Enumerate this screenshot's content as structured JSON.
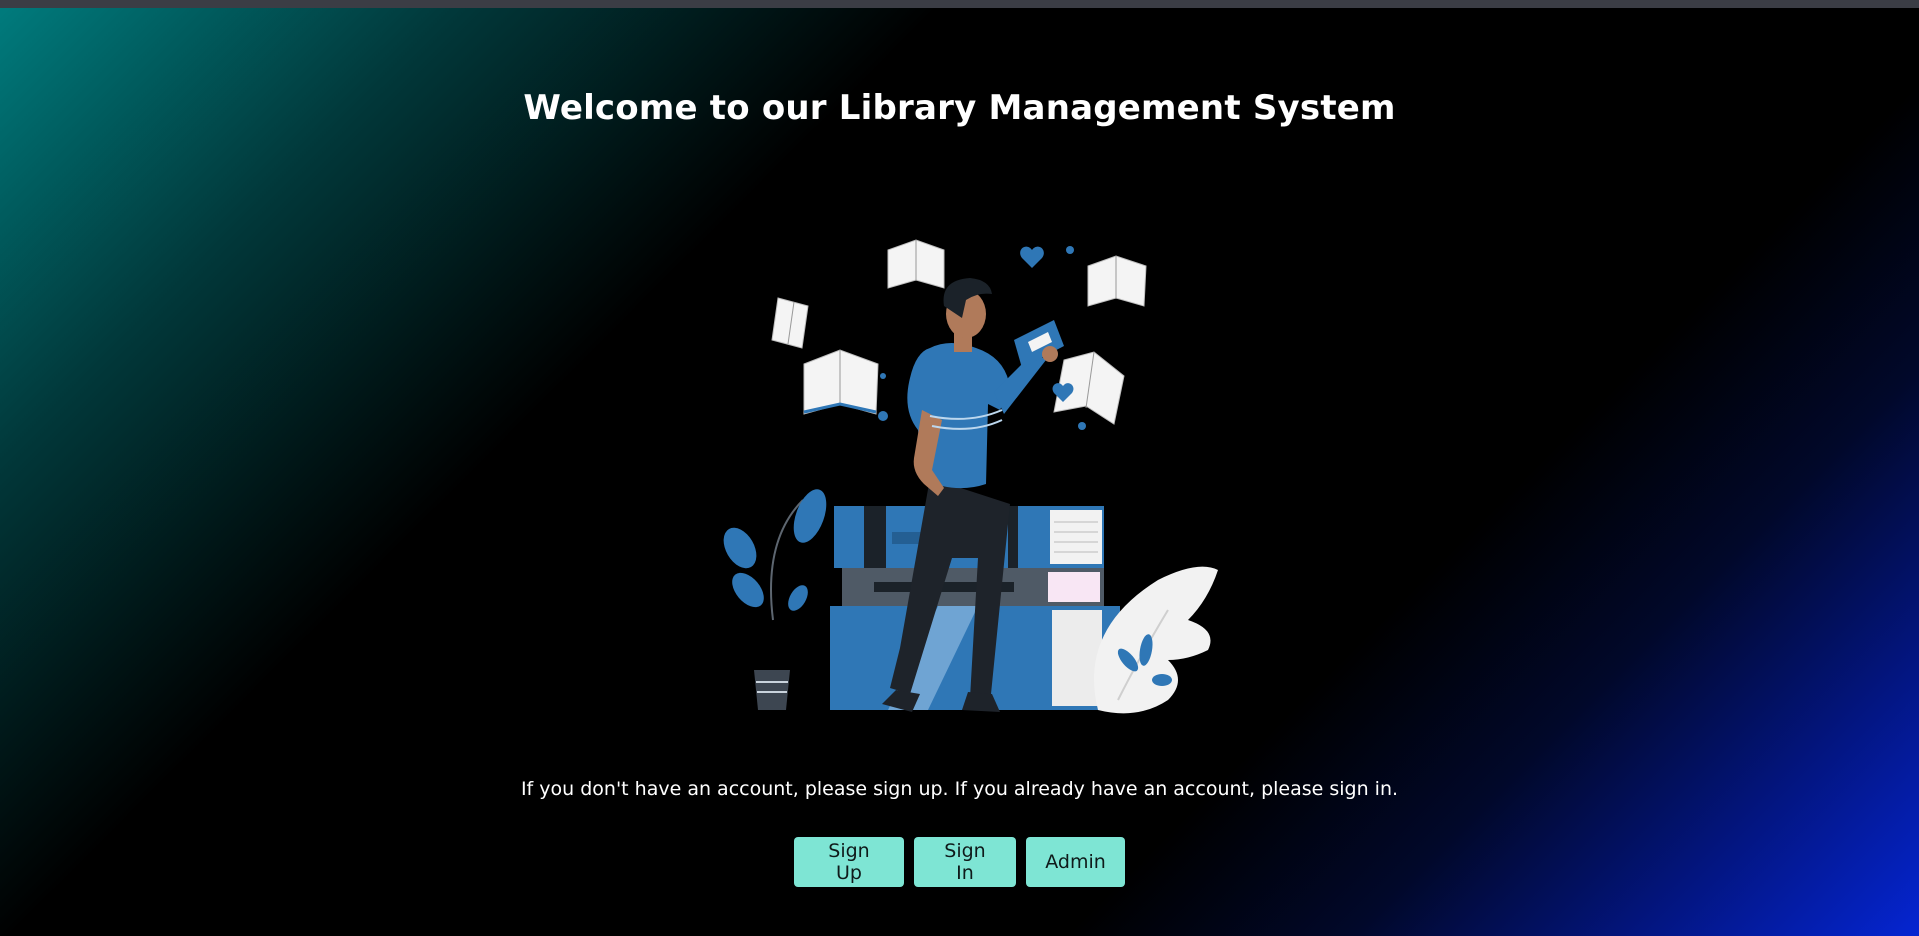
{
  "page": {
    "title": "Welcome to our Library Management System",
    "message": "If you don't have an account, please sign up. If you already have an account, please sign in."
  },
  "actions": {
    "signup_label": "Sign Up",
    "signin_label": "Sign In",
    "admin_label": "Admin"
  },
  "colors": {
    "button_bg": "#7ee5d4",
    "accent_blue": "#2f77b6",
    "gradient_teal": "#007b7d",
    "gradient_blue": "#0525d2"
  },
  "illustration": {
    "icon": "library-reader-illustration"
  }
}
